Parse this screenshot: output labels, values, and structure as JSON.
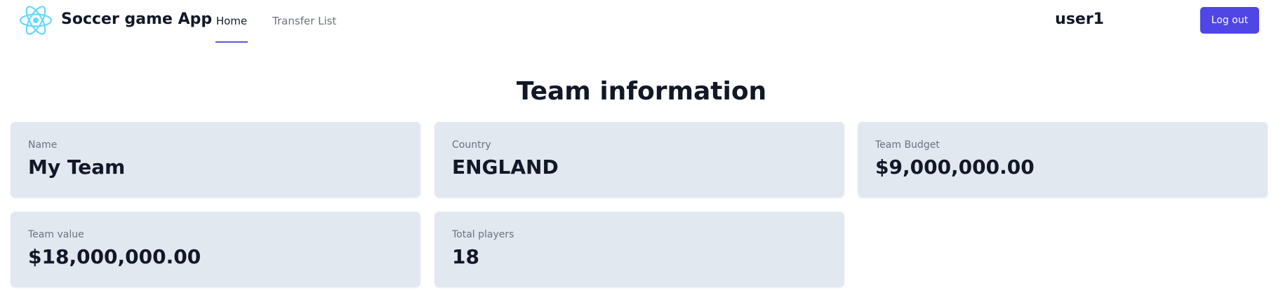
{
  "navbar": {
    "app_title": "Soccer game App",
    "logo_icon": "react-atom-icon",
    "tabs": [
      {
        "label": "Home",
        "active": true
      },
      {
        "label": "Transfer List",
        "active": false
      }
    ],
    "username": "user1",
    "logout_label": "Log out"
  },
  "colors": {
    "accent": "#4f46e5",
    "card_bg": "#e2e8f0",
    "logo": "#61dafb"
  },
  "main": {
    "heading": "Team information",
    "cards": [
      {
        "label": "Name",
        "value": "My Team"
      },
      {
        "label": "Country",
        "value": "ENGLAND"
      },
      {
        "label": "Team Budget",
        "value": "$9,000,000.00"
      },
      {
        "label": "Team value",
        "value": "$18,000,000.00"
      },
      {
        "label": "Total players",
        "value": "18"
      }
    ]
  }
}
